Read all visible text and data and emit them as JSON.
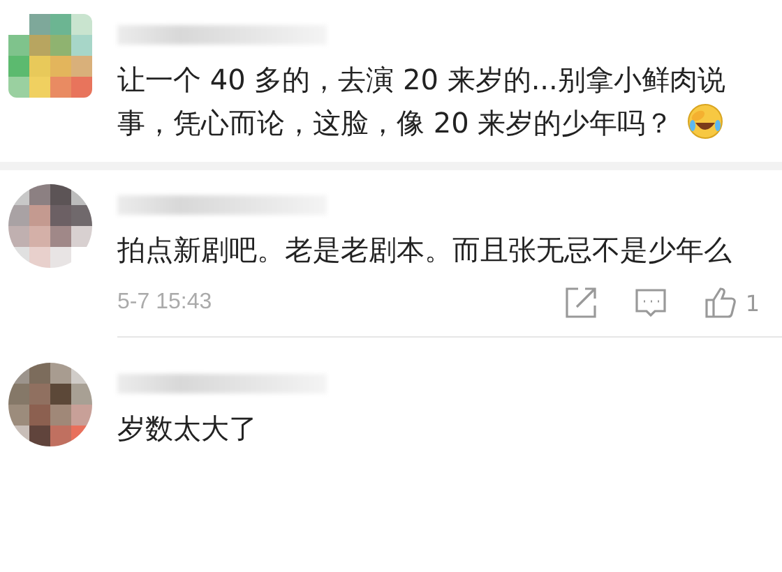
{
  "comments": [
    {
      "text": "让一个 40 多的，去演 20 来岁的...别拿小鲜肉说事，凭心而论，这脸，像 20 来岁的少年吗？",
      "emoji": true,
      "avatar": {
        "kind": "square"
      }
    },
    {
      "text": "拍点新剧吧。老是老剧本。而且张无忌不是少年么",
      "time": "5-7 15:43",
      "likes": "1",
      "avatar": {
        "kind": "round"
      }
    },
    {
      "text": "岁数太大了",
      "avatar": {
        "kind": "round"
      }
    }
  ]
}
